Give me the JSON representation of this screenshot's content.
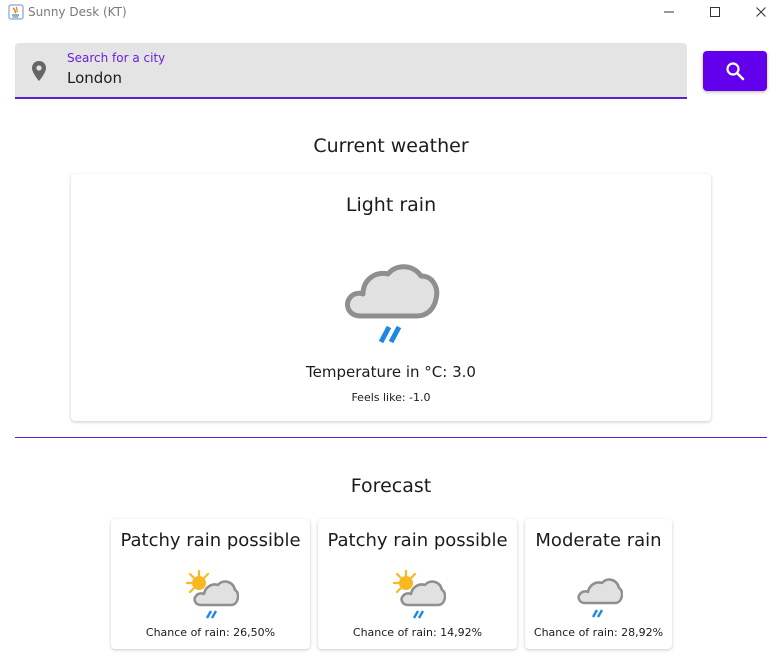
{
  "window": {
    "title": "Sunny Desk (KT)"
  },
  "search": {
    "label": "Search for a city",
    "value": "London",
    "button_icon": "search-icon"
  },
  "current": {
    "section_title": "Current weather",
    "condition": "Light rain",
    "icon": "cloud-rain-icon",
    "temperature": "Temperature in °C: 3.0",
    "feels_like": "Feels like: -1.0"
  },
  "forecast": {
    "section_title": "Forecast",
    "items": [
      {
        "condition": "Patchy rain possible",
        "icon": "sun-cloud-rain-icon",
        "chance": "Chance of rain: 26,50%"
      },
      {
        "condition": "Patchy rain possible",
        "icon": "sun-cloud-rain-icon",
        "chance": "Chance of rain: 14,92%"
      },
      {
        "condition": "Moderate rain",
        "icon": "cloud-rain-icon",
        "chance": "Chance of rain: 28,92%"
      }
    ]
  },
  "colors": {
    "accent": "#6200ee",
    "underline": "#5a1fd6",
    "rain": "#1e88e5",
    "sun": "#f9b820",
    "cloud": "#8f8f8f"
  }
}
